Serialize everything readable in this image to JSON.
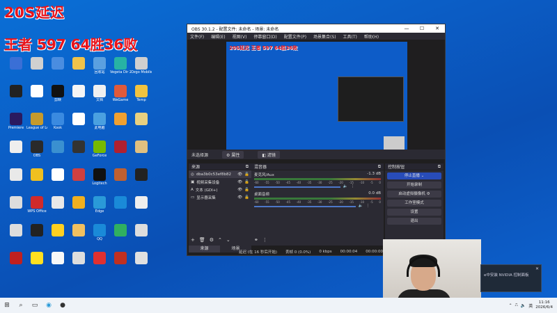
{
  "overlay": {
    "line1": "20S延迟",
    "line2": "王者 597  64胜36败"
  },
  "desktop_icons": [
    {
      "label": "",
      "color": "#3a6fd6"
    },
    {
      "label": "",
      "color": "#d0d0d0"
    },
    {
      "label": "",
      "color": "#4a8de0"
    },
    {
      "label": "",
      "color": "#f0c34a"
    },
    {
      "label": "回收站",
      "color": "#5aa0e0"
    },
    {
      "label": "Vegeta Dir 2",
      "color": "#27b3a4"
    },
    {
      "label": "Ozgo Mobile",
      "color": "#cfcfcf"
    },
    {
      "label": "",
      "color": "#222222"
    },
    {
      "label": "",
      "color": "#ffffff"
    },
    {
      "label": "剪映",
      "color": "#111111"
    },
    {
      "label": "",
      "color": "#f5f5f5"
    },
    {
      "label": "文档",
      "color": "#f0f0f0"
    },
    {
      "label": "WeGame",
      "color": "#e05a3a"
    },
    {
      "label": "Temp",
      "color": "#f2c33f"
    },
    {
      "label": "Premiere",
      "color": "#2a1a60"
    },
    {
      "label": "League of Legends",
      "color": "#c59a2c"
    },
    {
      "label": "Kook",
      "color": "#3a8ae0"
    },
    {
      "label": "",
      "color": "#ffffff"
    },
    {
      "label": "此电脑",
      "color": "#4aa0e0"
    },
    {
      "label": "",
      "color": "#f0a030"
    },
    {
      "label": "",
      "color": "#e8d080"
    },
    {
      "label": "",
      "color": "#eeeeee"
    },
    {
      "label": "OBS",
      "color": "#2a2a2a"
    },
    {
      "label": "",
      "color": "#3a90d0"
    },
    {
      "label": "",
      "color": "#333333"
    },
    {
      "label": "GeForce",
      "color": "#76b900"
    },
    {
      "label": "",
      "color": "#b02030"
    },
    {
      "label": "",
      "color": "#e0c080"
    },
    {
      "label": "",
      "color": "#e9e9e9"
    },
    {
      "label": "",
      "color": "#f0c020"
    },
    {
      "label": "",
      "color": "#ffffff"
    },
    {
      "label": "",
      "color": "#d04040"
    },
    {
      "label": "Logitech",
      "color": "#111111"
    },
    {
      "label": "",
      "color": "#c06030"
    },
    {
      "label": "",
      "color": "#222222"
    },
    {
      "label": "",
      "color": "#dddddd"
    },
    {
      "label": "WPS Office",
      "color": "#d02a2a"
    },
    {
      "label": "",
      "color": "#e8e8e8"
    },
    {
      "label": "",
      "color": "#f0b020"
    },
    {
      "label": "Edge",
      "color": "#2a9ad8"
    },
    {
      "label": "",
      "color": "#1a8ad8"
    },
    {
      "label": "",
      "color": "#eeeeee"
    },
    {
      "label": "",
      "color": "#dddddd"
    },
    {
      "label": "",
      "color": "#222222"
    },
    {
      "label": "",
      "color": "#ffd020"
    },
    {
      "label": "",
      "color": "#f0c060"
    },
    {
      "label": "QQ",
      "color": "#1a8ad8"
    },
    {
      "label": "",
      "color": "#30b060"
    },
    {
      "label": "",
      "color": "#ddd"
    },
    {
      "label": "",
      "color": "#c02020"
    },
    {
      "label": "",
      "color": "#ffe020"
    },
    {
      "label": "",
      "color": "#f8f8f8"
    },
    {
      "label": "",
      "color": "#dddddd"
    },
    {
      "label": "",
      "color": "#e03030"
    },
    {
      "label": "",
      "color": "#c03020"
    },
    {
      "label": "",
      "color": "#e0e0e0"
    },
    {
      "label": "",
      "color": "#e0e0e0"
    },
    {
      "label": "",
      "color": "#3a80d0"
    },
    {
      "label": "",
      "color": "#2a7ad0"
    },
    {
      "label": "",
      "color": "#3aa0e0"
    }
  ],
  "obs": {
    "title": "OBS 30.1.2 - 配置文件: 未命名 - 场景: 未命名",
    "menu": [
      "文件(F)",
      "编辑(E)",
      "视图(V)",
      "停靠窗口(D)",
      "配置文件(P)",
      "场景集合(S)",
      "工具(T)",
      "帮助(H)"
    ],
    "preview_overlay": "20S延迟 王者 597 64胜36败",
    "no_source": "未选择源",
    "props_btn": "属性",
    "filters_btn": "滤镜",
    "sources_title": "来源",
    "sources": [
      {
        "name": "dba3b0c53ef8b82",
        "icon": "◎"
      },
      {
        "name": "视频采集设备",
        "icon": "▣"
      },
      {
        "name": "文本 (GDI+)",
        "icon": "A"
      },
      {
        "name": "显示器采集",
        "icon": "▭"
      }
    ],
    "mixer_title": "混音器",
    "channels": [
      {
        "name": "麦克风/Aux",
        "db": "-1.3 dB",
        "level": 0.85
      },
      {
        "name": "桌面音频",
        "db": "0.0 dB",
        "level": 1.0
      }
    ],
    "scale": [
      "-60",
      "-55",
      "-50",
      "-45",
      "-40",
      "-35",
      "-30",
      "-25",
      "-20",
      "-15",
      "-10",
      "-5",
      "0"
    ],
    "controls_title": "控制按钮",
    "stop_stream": "停止直播",
    "start_record": "开始录制",
    "virtual_cam": "启动虚拟摄像机",
    "studio_mode": "工作室模式",
    "settings": "设置",
    "exit": "退出",
    "tabs": [
      "来源",
      "场景"
    ],
    "status": {
      "delay": "延迟 (在 16 秒后开始)",
      "dropped": "丢帧 0 (0.0%)",
      "kbps": "0 kbps",
      "stream_time": "00:00:04",
      "rec_time": "00:00:00"
    }
  },
  "notification": {
    "text": "e中安装 NVIDIA 控制面板",
    "close": "✕"
  },
  "taskbar": {
    "ime": "英",
    "time": "11:16",
    "date": "2026/6/4"
  }
}
